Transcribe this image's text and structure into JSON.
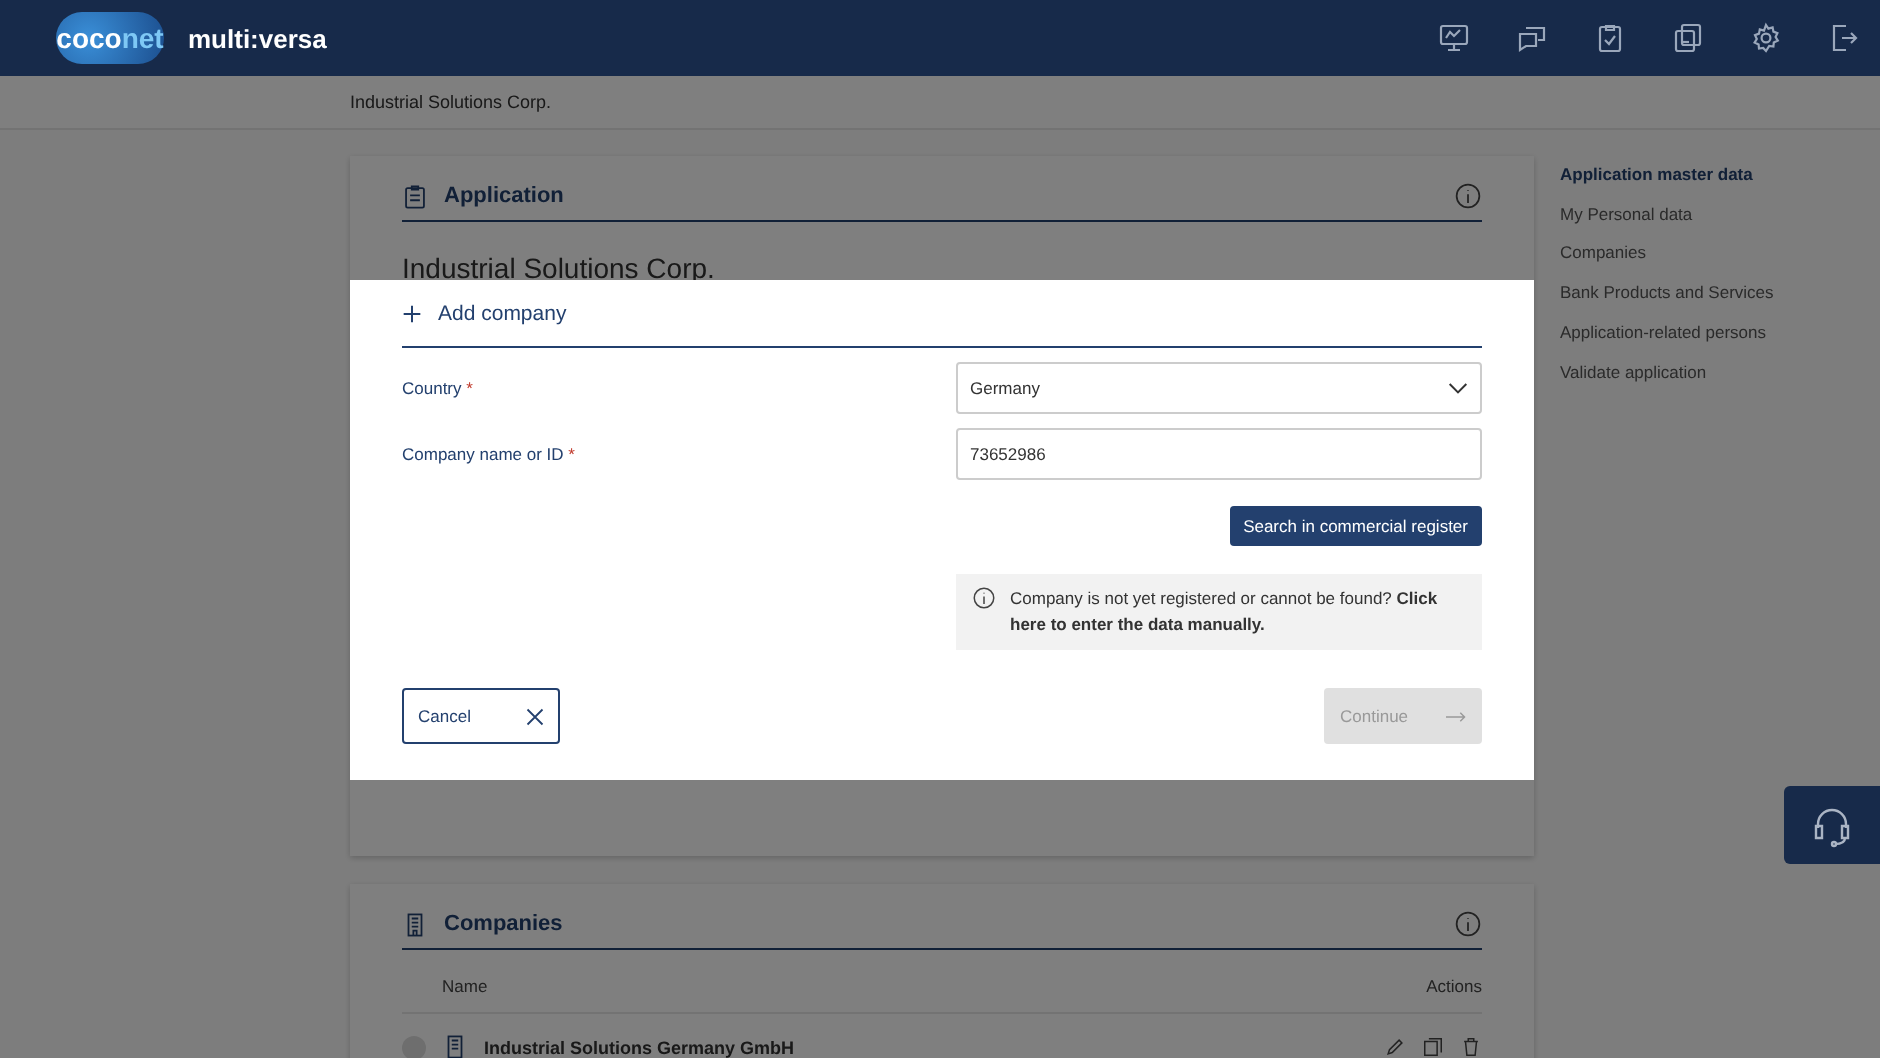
{
  "header": {
    "logo_parts": [
      "coco",
      "net"
    ],
    "app_name": "multi:versa"
  },
  "breadcrumb": "Industrial Solutions Corp.",
  "application_card": {
    "title": "Application",
    "subtitle": "Industrial Solutions Corp."
  },
  "side_nav": {
    "items": [
      {
        "label": "Application master data",
        "selected": true
      },
      {
        "label": "My Personal data",
        "selected": false
      },
      {
        "label": "Companies",
        "selected": false
      },
      {
        "label": "Bank Products and Services",
        "selected": false
      },
      {
        "label": "Application-related persons",
        "selected": false
      },
      {
        "label": "Validate application",
        "selected": false
      }
    ]
  },
  "companies_card": {
    "title": "Companies",
    "columns": [
      "Name",
      "Actions"
    ],
    "rows": [
      {
        "name": "Industrial Solutions Germany GmbH"
      }
    ]
  },
  "modal": {
    "title": "Add company",
    "fields": [
      {
        "kind": "select",
        "label": "Country",
        "required_mark": "*",
        "value": "Germany"
      },
      {
        "kind": "text",
        "label": "Company name or ID",
        "required_mark": "*",
        "value": "73652986"
      }
    ],
    "search_button": "Search in commercial register",
    "notice": "Company is not yet registered or cannot be found? **Click here to enter the data manually.**",
    "cancel_button": "Cancel",
    "continue_button": {
      "label": "Continue",
      "disabled": true
    }
  }
}
